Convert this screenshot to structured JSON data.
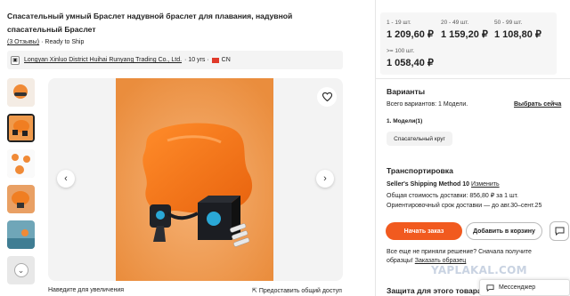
{
  "product": {
    "title": "Спасательный умный Браслет надувной браслет для плавания, надувной спасательный Браслет",
    "reviews": "(3 Отзывы)",
    "ready": "· Ready to Ship",
    "supplier": "Longyan Xinluo District Huihai Runyang Trading Co., Ltd.",
    "years": "· 10 yrs ·",
    "country": "CN"
  },
  "gallery": {
    "zoom_hint": "Наведите для увеличения",
    "share": "Предоставить общий доступ"
  },
  "price_tiers": [
    {
      "range": "1 - 19 шт.",
      "price": "1 209,60 ₽"
    },
    {
      "range": "20 - 49 шт.",
      "price": "1 159,20 ₽"
    },
    {
      "range": "50 - 99 шт.",
      "price": "1 108,80 ₽"
    },
    {
      "range": ">= 100 шт.",
      "price": "1 058,40 ₽"
    }
  ],
  "variants": {
    "heading": "Варианты",
    "total": "Всего вариантов: 1 Модели.",
    "choose": "Выбрать сейча",
    "model_label": "1. Модели(1)",
    "option": "Спасательный круг"
  },
  "shipping": {
    "heading": "Транспортировка",
    "method": "Seller's Shipping Method 10",
    "change": "Изменить",
    "cost": "Общая стоимость доставки: 856,80 ₽ за 1 шт.",
    "eta": "Ориентировочный срок доставки — до авг.30–сент.25"
  },
  "actions": {
    "order": "Начать заказ",
    "cart": "Добавить в корзину"
  },
  "sample": {
    "line1": "Все еще не приняли решение? Сначала получите",
    "line2": "образцы!",
    "link": "Заказать образец"
  },
  "protection": "Защита для этого товара",
  "watermark": "YAPLAKAL.COM",
  "messenger": "Мессенджер",
  "colors": {
    "accent": "#f15a1f",
    "product_bg": "#ef9a4c"
  }
}
